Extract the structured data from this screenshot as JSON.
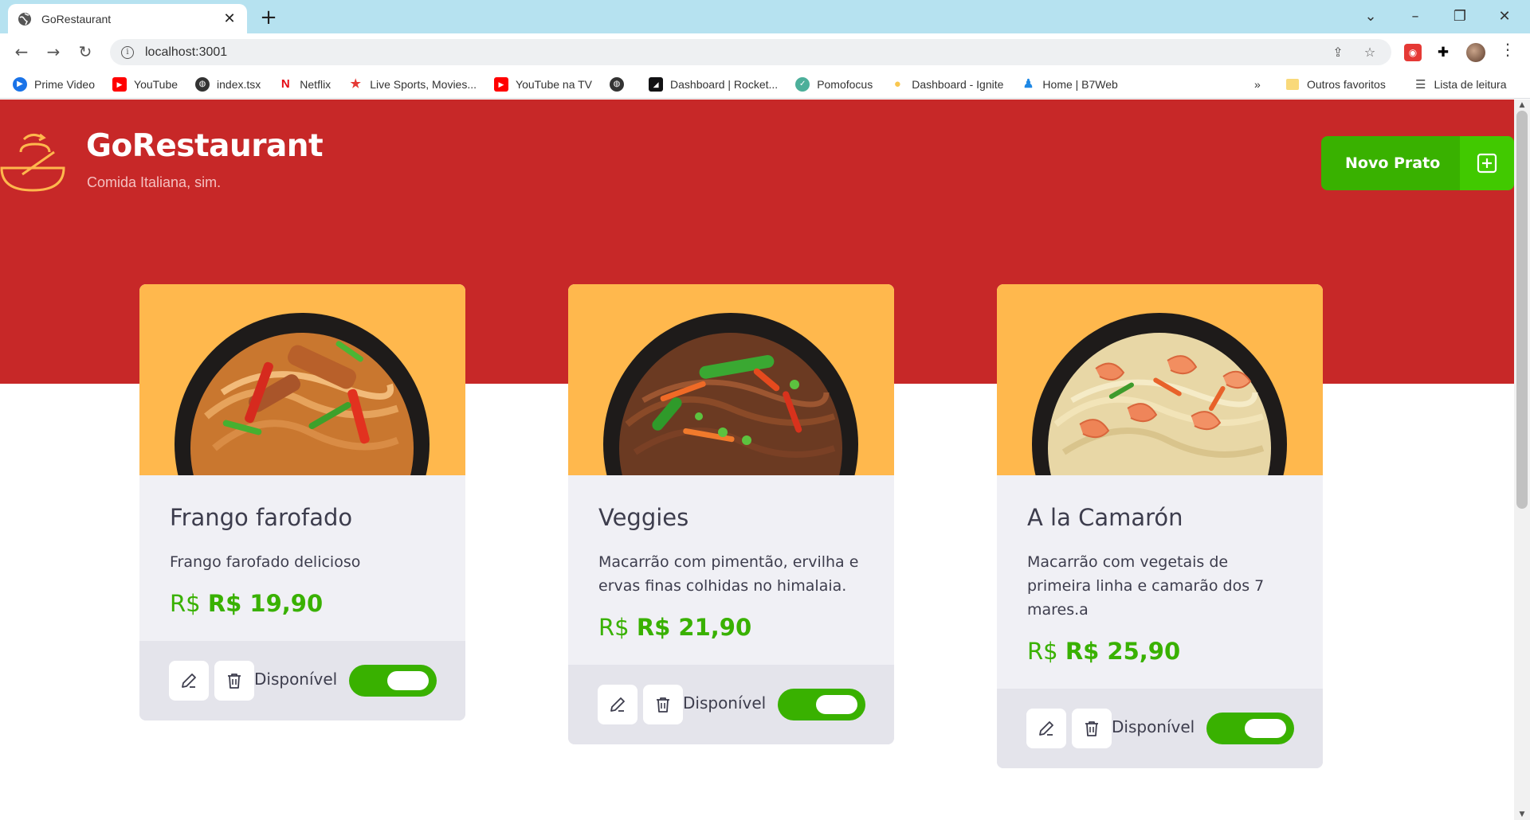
{
  "browser": {
    "tab_title": "GoRestaurant",
    "url": "localhost:3001",
    "bookmarks": [
      {
        "label": "Prime Video",
        "icon": "prime-video-icon",
        "color": "#1a73e8"
      },
      {
        "label": "YouTube",
        "icon": "youtube-icon",
        "color": "#ff0000"
      },
      {
        "label": "index.tsx",
        "icon": "globe-icon",
        "color": "#333333"
      },
      {
        "label": "Netflix",
        "icon": "netflix-icon",
        "color": "#e50914"
      },
      {
        "label": "Live Sports, Movies...",
        "icon": "star-icon",
        "color": "#e53935"
      },
      {
        "label": "YouTube na TV",
        "icon": "youtube-icon",
        "color": "#ff0000"
      },
      {
        "label": "",
        "icon": "globe-icon",
        "color": "#333333"
      },
      {
        "label": "Dashboard | Rocket...",
        "icon": "rocketseat-icon",
        "color": "#121214"
      },
      {
        "label": "Pomofocus",
        "icon": "check-circle-icon",
        "color": "#4caf9a"
      },
      {
        "label": "Dashboard - Ignite",
        "icon": "bulb-icon",
        "color": "#f9c74f"
      },
      {
        "label": "Home | B7Web",
        "icon": "b7web-icon",
        "color": "#1e88e5"
      }
    ],
    "more_label": "»",
    "other_bookmarks": "Outros favoritos",
    "reading_list": "Lista de leitura"
  },
  "header": {
    "brand": "GoRestaurant",
    "tagline": "Comida Italiana, sim.",
    "new_dish_label": "Novo Prato"
  },
  "colors": {
    "hero": "#c72828",
    "accent_green": "#39b100",
    "card_image_bg": "#ffb84d"
  },
  "dishes": [
    {
      "name": "Frango farofado",
      "description": "Frango farofado delicioso",
      "currency": "R$",
      "price": "R$ 19,90",
      "available_label": "Disponível",
      "available": true
    },
    {
      "name": "Veggies",
      "description": "Macarrão com pimentão, ervilha e ervas finas colhidas no himalaia.",
      "currency": "R$",
      "price": "R$ 21,90",
      "available_label": "Disponível",
      "available": true
    },
    {
      "name": "A la Camarón",
      "description": "Macarrão com vegetais de primeira linha e camarão dos 7 mares.a",
      "currency": "R$",
      "price": "R$ 25,90",
      "available_label": "Disponível",
      "available": true
    }
  ]
}
